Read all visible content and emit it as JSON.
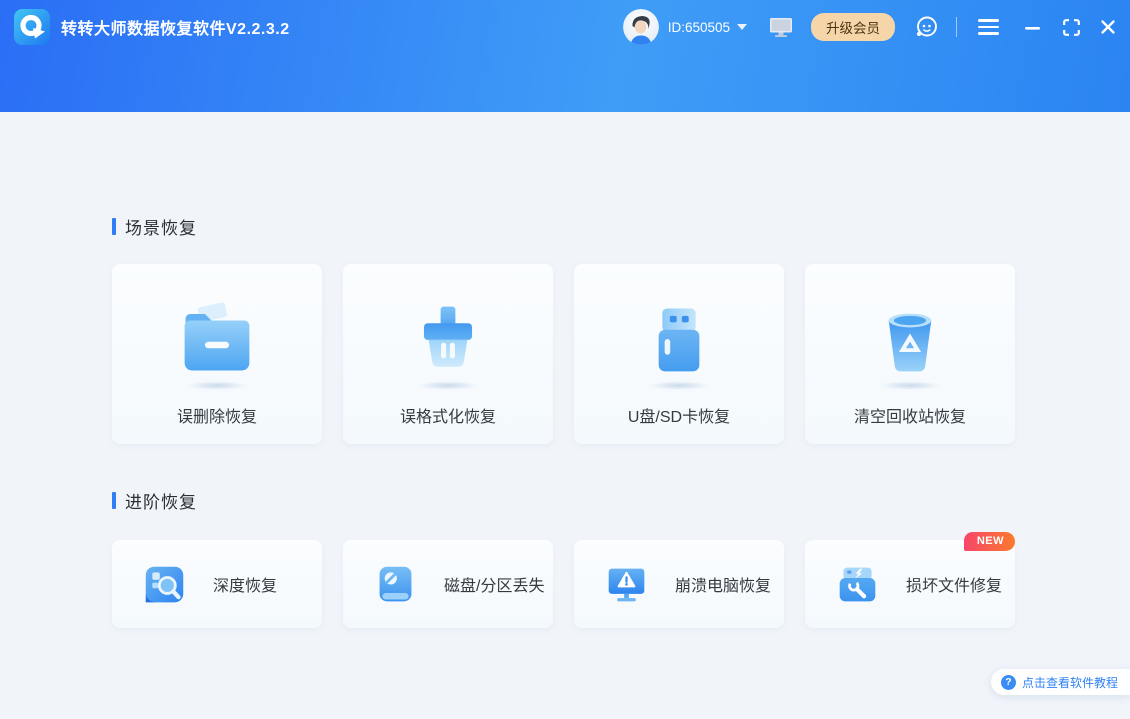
{
  "header": {
    "app_title": "转转大师数据恢复软件V2.2.3.2",
    "user_id": "ID:650505",
    "upgrade_button": "升级会员",
    "icons": [
      "app-logo-icon",
      "user-avatar",
      "dropdown-caret-icon",
      "monitor-icon",
      "customer-service-icon",
      "hamburger-menu-icon",
      "minimize-icon",
      "maximize-icon",
      "close-icon"
    ]
  },
  "sections": [
    {
      "title": "场景恢复",
      "cards": [
        {
          "label": "误删除恢复",
          "icon": "folder-icon"
        },
        {
          "label": "误格式化恢复",
          "icon": "brush-icon"
        },
        {
          "label": "U盘/SD卡恢复",
          "icon": "usb-drive-icon"
        },
        {
          "label": "清空回收站恢复",
          "icon": "recycle-bin-icon"
        }
      ]
    },
    {
      "title": "进阶恢复",
      "cards": [
        {
          "label": "深度恢复",
          "icon": "deep-scan-icon"
        },
        {
          "label": "磁盘/分区丢失",
          "icon": "disk-partition-icon"
        },
        {
          "label": "崩溃电脑恢复",
          "icon": "crashed-pc-icon"
        },
        {
          "label": "损坏文件修复",
          "icon": "file-repair-icon",
          "badge": "NEW"
        }
      ]
    }
  ],
  "tutorial_button": {
    "label": "点击查看软件教程",
    "icon_glyph": "?"
  },
  "colors": {
    "header_gradient": [
      "#2a6ef5",
      "#3f9df7",
      "#2b84f2"
    ],
    "body_background": "#f1f5fa",
    "accent_blue": "#2f7ef6",
    "upgrade_bg": "#f6d6a8",
    "upgrade_text": "#4c3414",
    "new_badge_gradient": [
      "#f8456b",
      "#fb7a2d"
    ],
    "tutorial_text": "#2f82f4"
  }
}
